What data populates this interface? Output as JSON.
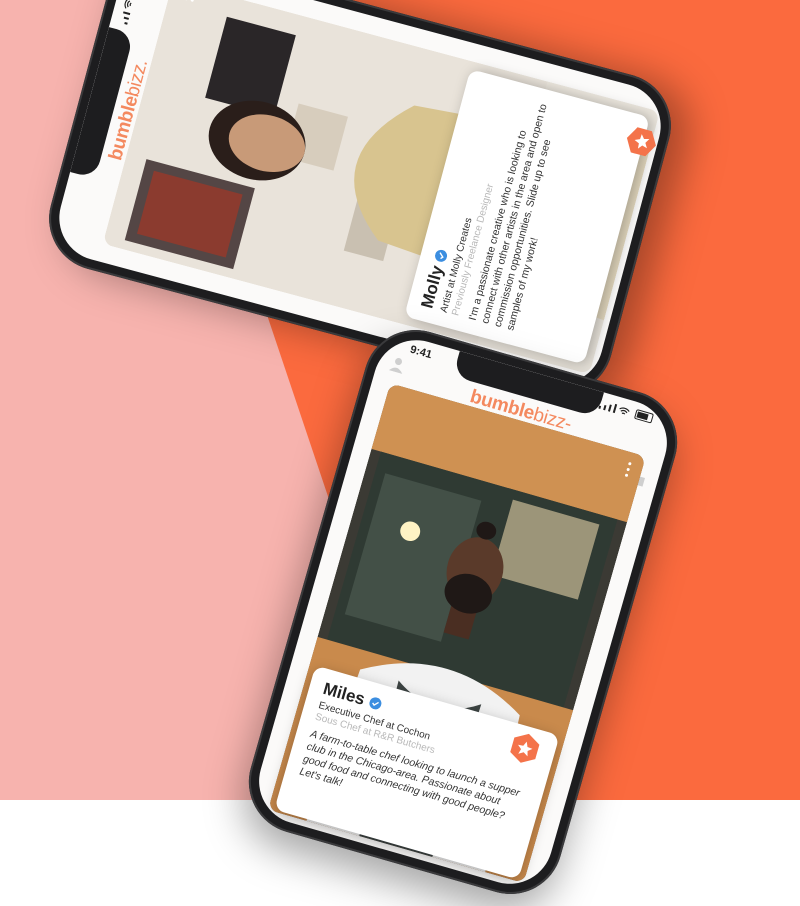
{
  "colors": {
    "accent": "#f4895f",
    "verified": "#3c8ee0",
    "bg_pink": "#f7b3ae",
    "bg_orange": "#fb6a3e"
  },
  "icons": [
    "profile-icon",
    "chat-icon",
    "verified-badge-icon",
    "star-badge-icon",
    "signal-icon",
    "wifi-icon",
    "battery-icon"
  ],
  "phone_top": {
    "logo": {
      "part1": "bumble",
      "part2": "bizz",
      "suffix": "."
    },
    "profile": {
      "name": "Molly",
      "job": "Artist at Molly Creates",
      "previous_job": "Previously Freelance Designer",
      "bio": "I'm a passionate creative who is looking to connect with other artists in the area and open to commission opportunities. Slide up to see samples of my work!"
    }
  },
  "phone_bottom": {
    "status_time": "9:41",
    "logo": {
      "part1": "bumble",
      "part2": "bizz",
      "suffix": "-"
    },
    "profile": {
      "name": "Miles",
      "job": "Executive Chef at Cochon",
      "previous_job": "Sous Chef at R&R Butchers",
      "bio": "A farm-to-table chef looking to launch a supper club in the Chicago-area. Passionate about good food and connecting with good people? Let's talk!"
    }
  }
}
